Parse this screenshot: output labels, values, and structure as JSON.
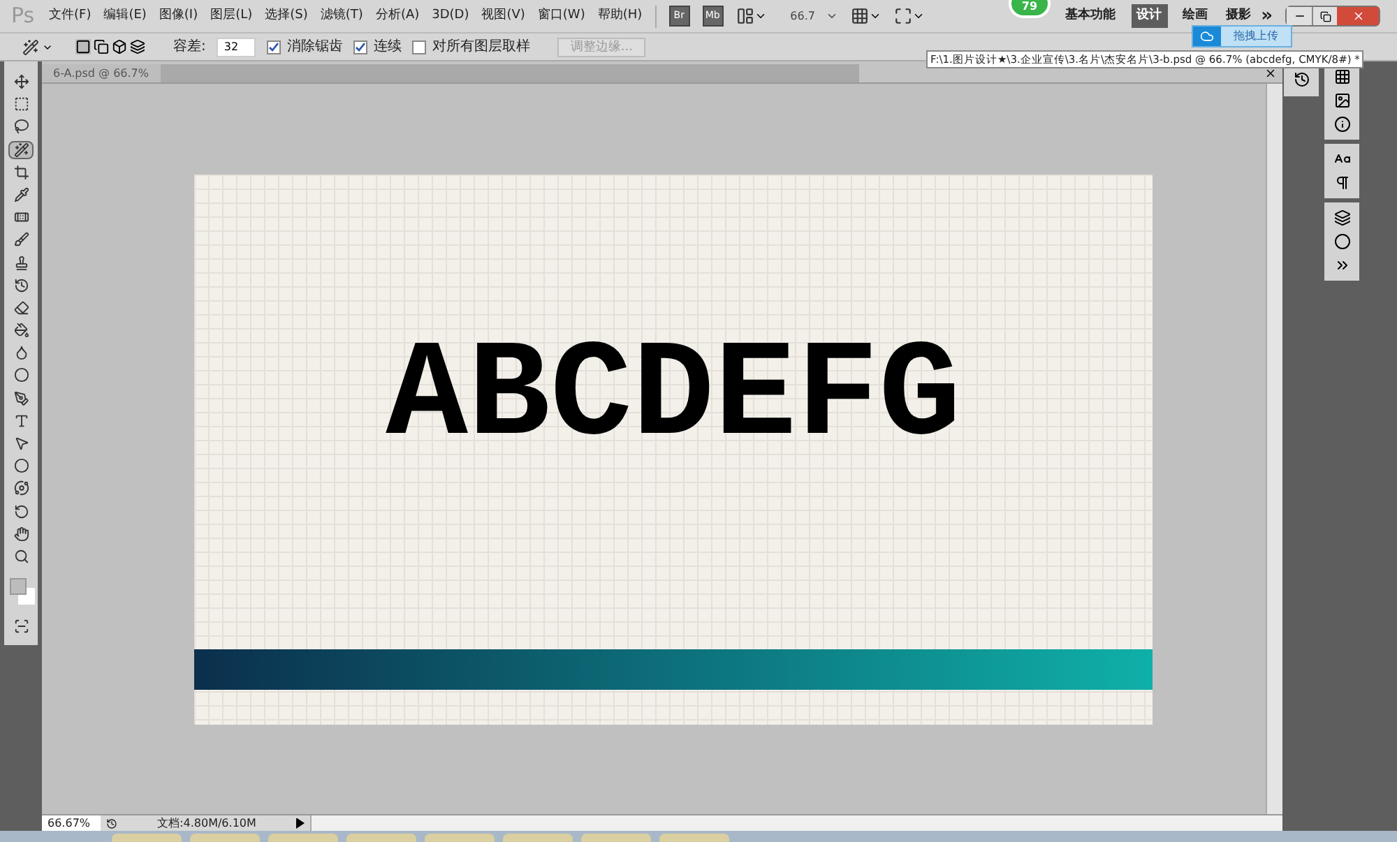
{
  "menu": {
    "logo": "Ps",
    "items": [
      "文件(F)",
      "编辑(E)",
      "图像(I)",
      "图层(L)",
      "选择(S)",
      "滤镜(T)",
      "分析(A)",
      "3D(D)",
      "视图(V)",
      "窗口(W)",
      "帮助(H)"
    ]
  },
  "app_buttons": [
    "Br",
    "Mb"
  ],
  "zoom_dropdown": "66.7",
  "badge": "79",
  "workspaces": [
    {
      "label": "基本功能",
      "selected": false
    },
    {
      "label": "设计",
      "selected": true
    },
    {
      "label": "绘画",
      "selected": false
    },
    {
      "label": "摄影",
      "selected": false
    }
  ],
  "more": "»",
  "options": {
    "tolerance_label": "容差:",
    "tolerance": "32",
    "checkboxes": [
      {
        "label": "消除锯齿",
        "checked": true
      },
      {
        "label": "连续",
        "checked": true
      },
      {
        "label": "对所有图层取样",
        "checked": false
      }
    ],
    "refine_button": {
      "label": "调整边缘...",
      "disabled": true
    }
  },
  "upload_popup": "拖拽上传",
  "tooltip": "F:\\1.图片设计★\\3.企业宣传\\3.名片\\杰安名片\\3-b.psd @ 66.7% (abcdefg, CMYK/8#) *",
  "document": {
    "tab": "6-A.psd @ 66.7%",
    "text": "ABCDEFG"
  },
  "tools": [
    {
      "selected": false
    },
    {
      "selected": false
    },
    {
      "selected": false
    },
    {
      "selected": true
    },
    {
      "selected": false
    },
    {
      "selected": false
    },
    {
      "selected": false
    },
    {
      "selected": false
    },
    {
      "selected": false
    },
    {
      "selected": false
    },
    {
      "selected": false
    },
    {
      "selected": false
    },
    {
      "selected": false
    },
    {
      "selected": false
    },
    {
      "selected": false
    },
    {
      "selected": false
    },
    {
      "selected": false
    },
    {
      "selected": false
    },
    {
      "selected": false
    },
    {
      "selected": false
    },
    {
      "selected": false
    },
    {
      "selected": false
    }
  ],
  "status_bar": {
    "zoom": "66.67%",
    "doc_info": "文档:4.80M/6.10M"
  }
}
